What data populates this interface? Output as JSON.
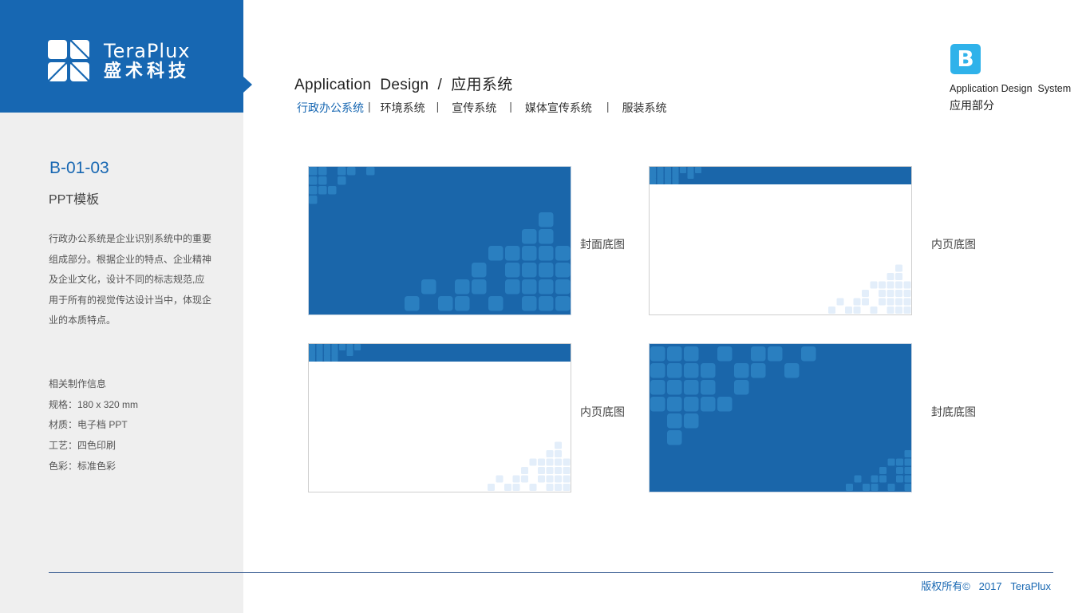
{
  "brand": {
    "name_en": "TeraPlux",
    "name_cn": "盛术科技",
    "color": "#1767b2"
  },
  "sidebar": {
    "code": "B-01-03",
    "subtitle": "PPT模板",
    "description": "行政办公系统是企业识别系统中的重要组成部分。根据企业的特点、企业精神及企业文化，设计不同的标志规范,应用于所有的视觉传达设计当中，体现企业的本质特点。",
    "info": [
      "相关制作信息",
      "规格：180 x 320 mm",
      "材质：电子档 PPT",
      "工艺：四色印刷",
      "色彩：标准色彩"
    ]
  },
  "header": {
    "title": "Application  Design  /  应用系统",
    "tabs": [
      {
        "label": "行政办公系统",
        "active": true
      },
      {
        "label": "环境系统",
        "active": false
      },
      {
        "label": "宣传系统",
        "active": false
      },
      {
        "label": "媒体宣传系统",
        "active": false
      },
      {
        "label": "服装系统",
        "active": false
      }
    ],
    "separator": "|"
  },
  "section_badge": {
    "letter": "B",
    "title_en": "Application Design  System",
    "title_cn": "应用部分",
    "color": "#2fb2ea"
  },
  "thumbnails": [
    {
      "id": "cover",
      "caption": "封面底图"
    },
    {
      "id": "inner1",
      "caption": "内页底图"
    },
    {
      "id": "inner2",
      "caption": "内页底图"
    },
    {
      "id": "back",
      "caption": "封底底图"
    }
  ],
  "colors": {
    "primary_blue": "#1a66aa",
    "tile_blue": "#2a7fc0",
    "tile_light": "#e3eefa"
  },
  "footer": {
    "copyright": "版权所有©   2017   TeraPlux"
  }
}
